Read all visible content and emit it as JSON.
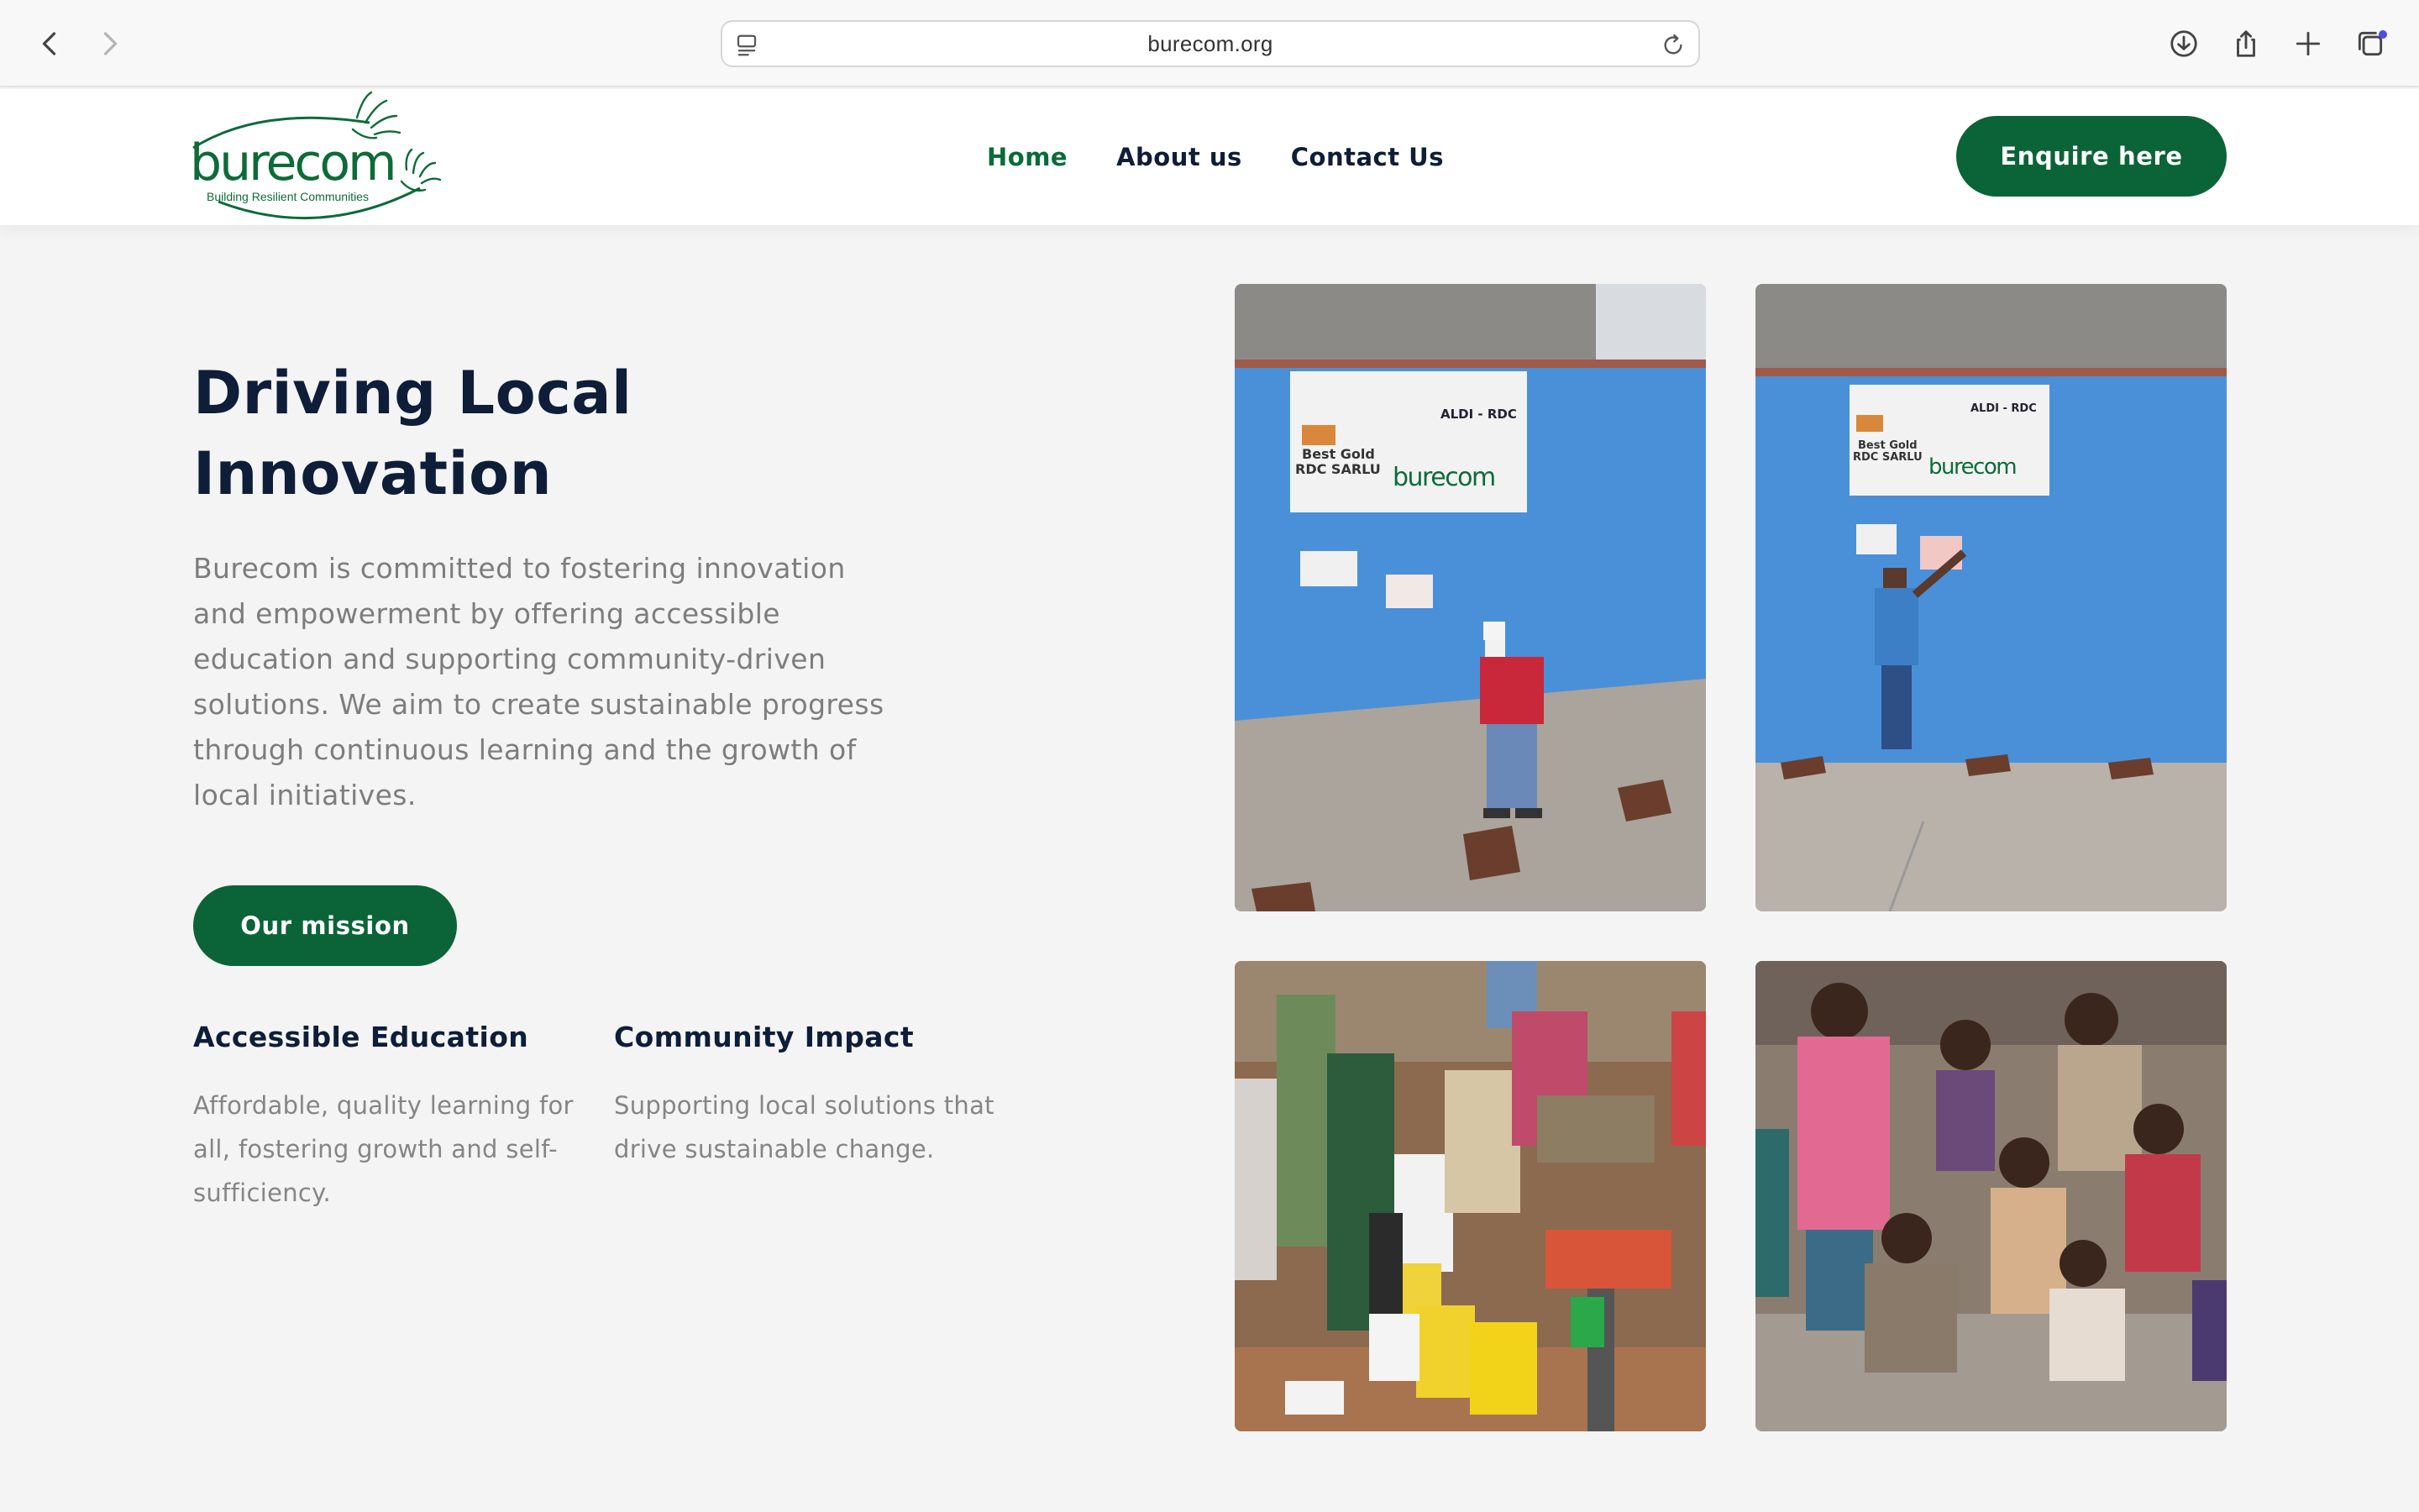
{
  "browser": {
    "url": "burecom.org",
    "icons": [
      "back-icon",
      "forward-icon",
      "page-menu-icon",
      "reload-icon",
      "download-icon",
      "share-icon",
      "new-tab-icon",
      "tabs-overview-icon"
    ]
  },
  "header": {
    "logo_text": "burecom",
    "logo_tagline": "Building Resilient Communities",
    "nav": [
      {
        "label": "Home",
        "active": true
      },
      {
        "label": "About us",
        "active": false
      },
      {
        "label": "Contact Us",
        "active": false
      }
    ],
    "cta_label": "Enquire here"
  },
  "hero": {
    "title_line1": "Driving Local",
    "title_line2": "Innovation",
    "description": "Burecom is committed to fostering innovation and empowerment by offering accessible education and supporting community-driven solutions. We aim to create sustainable progress through continuous learning and the growth of local initiatives.",
    "button_label": "Our mission"
  },
  "features": [
    {
      "title": "Accessible Education",
      "text": "Affordable, quality learning for all, fostering growth and self-sufficiency."
    },
    {
      "title": "Community Impact",
      "text": "Supporting local solutions that drive sustainable change."
    }
  ],
  "photos": {
    "sign_text_1": "ALDI - RDC",
    "sign_text_2": "Best Gold",
    "sign_text_3": "RDC SARLU",
    "sign_text_4": "burecom"
  },
  "colors": {
    "brand_green": "#0b6437",
    "nav_active": "#0a6b3a",
    "heading_navy": "#0e1d38",
    "body_grey": "#7d7d7d",
    "page_bg": "#f4f4f4"
  }
}
